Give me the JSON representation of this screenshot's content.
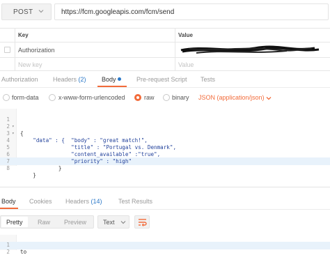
{
  "request": {
    "method": "POST",
    "url": "https://fcm.googleapis.com/fcm/send"
  },
  "headers_table": {
    "col_key": "Key",
    "col_value": "Value",
    "rows": [
      {
        "key": "Authorization",
        "value": ""
      }
    ],
    "new_key_placeholder": "New key",
    "value_placeholder": "Value"
  },
  "request_tabs": [
    {
      "label": "Authorization"
    },
    {
      "label": "Headers",
      "count": "(2)"
    },
    {
      "label": "Body"
    },
    {
      "label": "Pre-request Script"
    },
    {
      "label": "Tests"
    }
  ],
  "body_types": {
    "form_data": "form-data",
    "urlencoded": "x-www-form-urlencoded",
    "raw": "raw",
    "binary": "binary",
    "content_type": "JSON (application/json)",
    "selected": "raw"
  },
  "editor": {
    "lines": [
      "{",
      "    \"data\" : {",
      "                \"body\" : \"great match!\",",
      "                \"title\" : \"Portugal vs. Denmark\",",
      "                \"content_available\" :\"true\",",
      "                \"priority\" : \"high\"",
      "            }",
      "    }"
    ],
    "line_numbers": [
      "1",
      "2",
      "3",
      "4",
      "5",
      "6",
      "7",
      "8"
    ]
  },
  "response_tabs": [
    {
      "label": "Body"
    },
    {
      "label": "Cookies"
    },
    {
      "label": "Headers",
      "count": "(14)"
    },
    {
      "label": "Test Results"
    }
  ],
  "response_toolbar": {
    "pretty": "Pretty",
    "raw": "Raw",
    "preview": "Preview",
    "format": "Text"
  },
  "response_body": {
    "lines": [
      "to",
      ""
    ],
    "line_numbers": [
      "1",
      "2"
    ]
  },
  "colors": {
    "accent": "#f26b3a",
    "link_blue": "#2a78c8"
  }
}
